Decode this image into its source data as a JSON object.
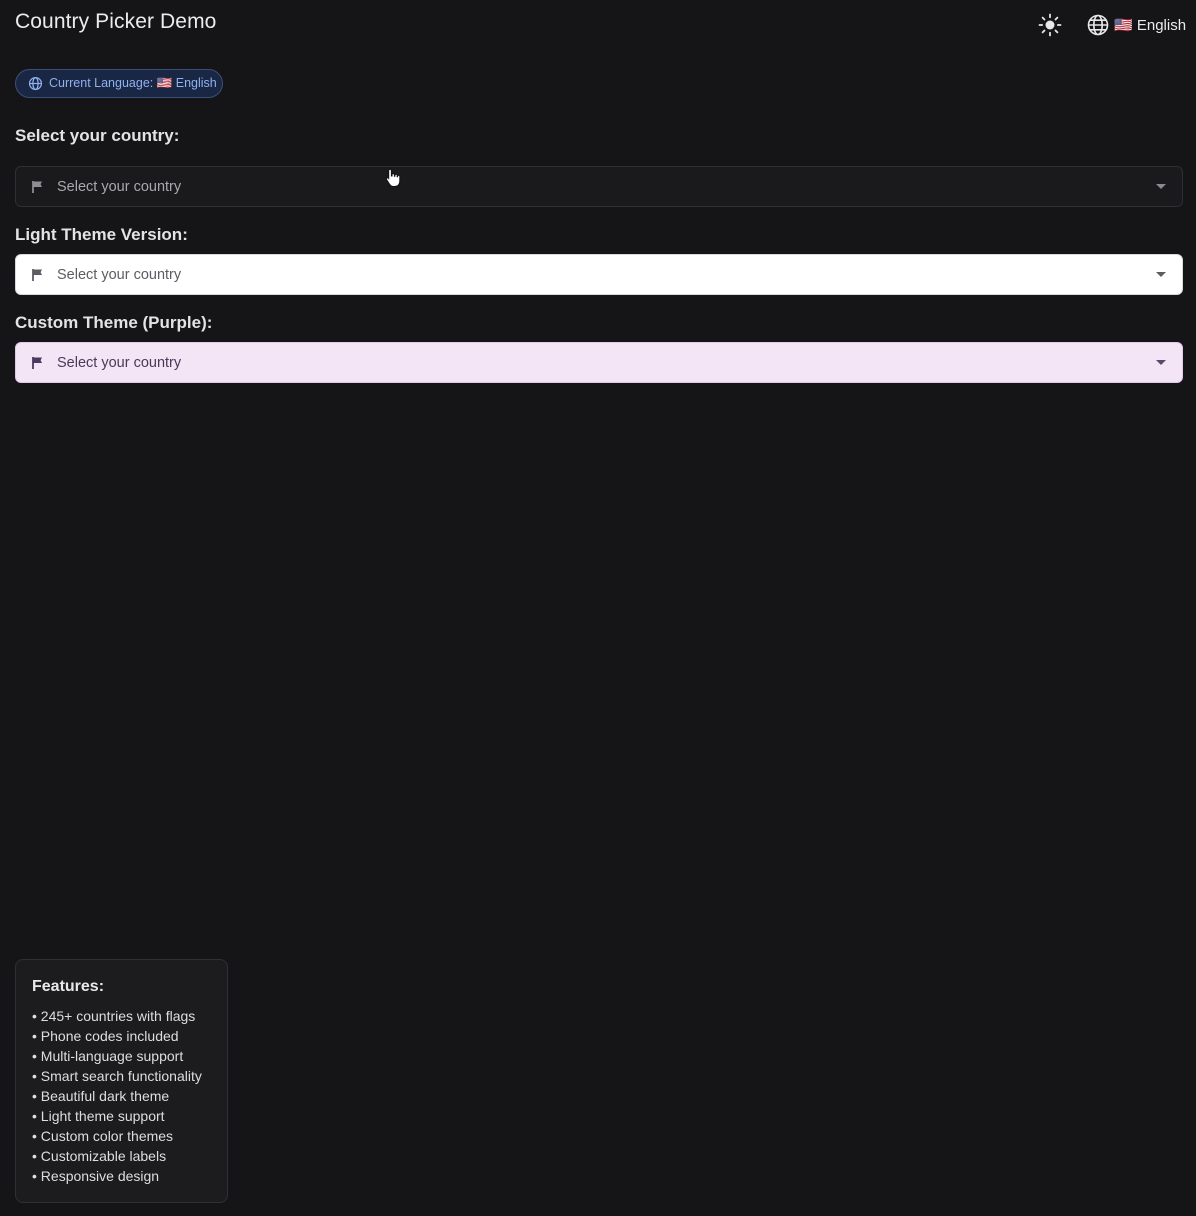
{
  "app": {
    "title": "Country Picker Demo",
    "theme_toggle_icon": "sun-icon",
    "language_switch": {
      "icon": "globe-icon",
      "label": "🇺🇸 English"
    }
  },
  "language_chip": {
    "icon": "globe-icon",
    "text": "Current Language: 🇺🇸 English"
  },
  "sections": {
    "default": {
      "label": "Select your country:",
      "placeholder": "Select your country",
      "icon": "flag-icon"
    },
    "light": {
      "label": "Light Theme Version:",
      "placeholder": "Select your country",
      "icon": "flag-icon"
    },
    "purple": {
      "label": "Custom Theme (Purple):",
      "placeholder": "Select your country",
      "icon": "flag-icon"
    }
  },
  "features": {
    "title": "Features:",
    "items": [
      "• 245+ countries with flags",
      "• Phone codes included",
      "• Multi-language support",
      "• Smart search functionality",
      "• Beautiful dark theme",
      "• Light theme support",
      "• Custom color themes",
      "• Customizable labels",
      "• Responsive design"
    ]
  },
  "colors": {
    "background": "#151517",
    "chip_text": "#8fb1f0",
    "purple_field": "#f3e5f5"
  }
}
